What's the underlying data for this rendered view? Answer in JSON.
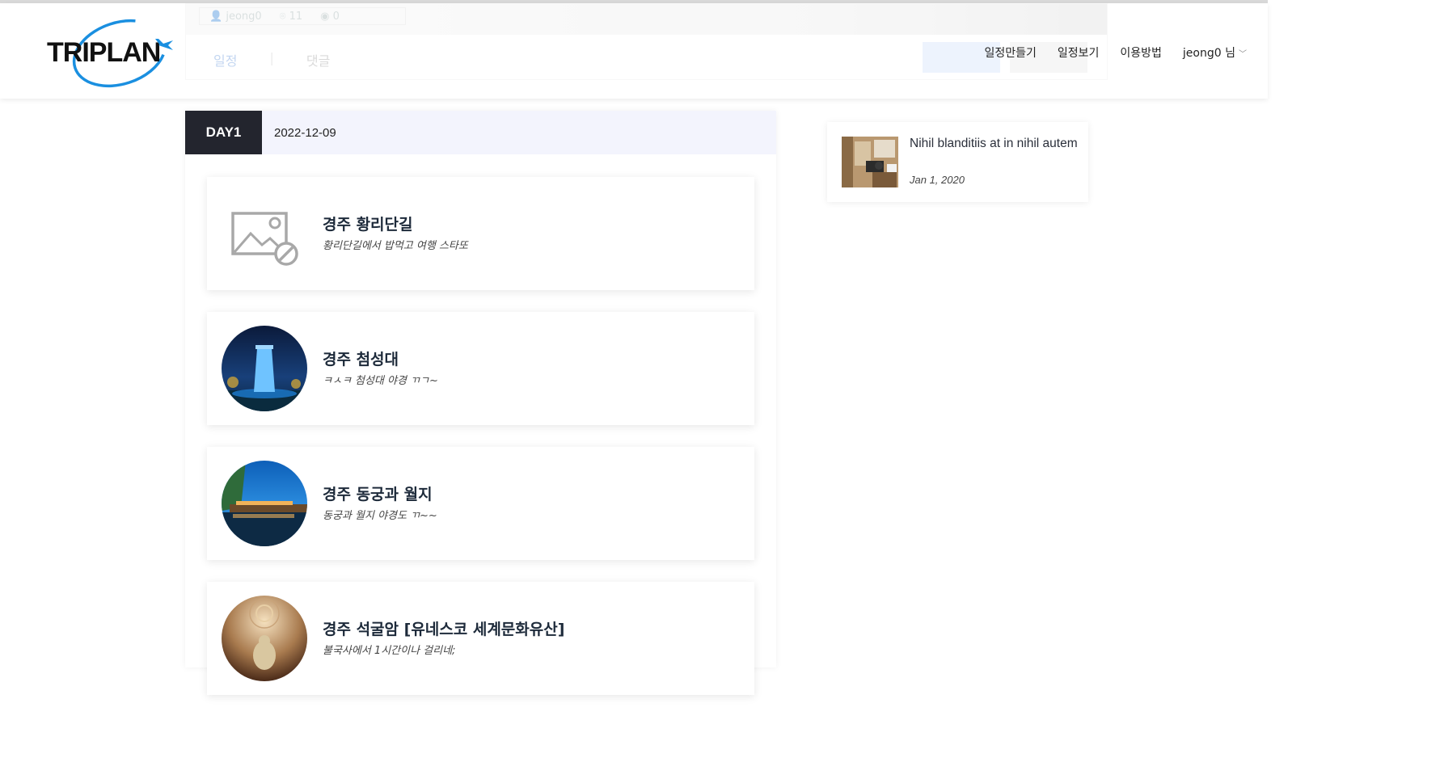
{
  "brand": {
    "logo_text": "TRIPLAN"
  },
  "underlay": {
    "author": "jeong0",
    "location_count": "11",
    "view_count": "0",
    "tab_schedule": "일정",
    "tab_comments": "댓글",
    "separator": "|"
  },
  "nav": {
    "create": "일정만들기",
    "view": "일정보기",
    "howto": "이용방법",
    "user": "jeong0 님"
  },
  "day": {
    "label": "DAY1",
    "date": "2022-12-09"
  },
  "places": [
    {
      "title": "경주 황리단길",
      "desc": "황리단길에서 밥먹고 여행 스타또",
      "image": "no-image"
    },
    {
      "title": "경주 첨성대",
      "desc": "ㅋㅅㅋ 첨성대 야경 ㄲㄱ~",
      "image": "cheomseongdae-night"
    },
    {
      "title": "경주 동궁과 월지",
      "desc": "동궁과 월지 야경도 ㄲ~~",
      "image": "donggung-wolji-night"
    },
    {
      "title": "경주 석굴암 [유네스코 세계문화유산]",
      "desc": "불국사에서 1시간이나 걸리네;",
      "image": "seokguram-buddha"
    }
  ],
  "sidebar": {
    "post_title": "Nihil blanditiis at in nihil autem",
    "post_date": "Jan 1, 2020"
  },
  "colors": {
    "day_badge": "#23252e",
    "day_header": "#f3f4fd",
    "logo_blue": "#1a8fe0"
  }
}
